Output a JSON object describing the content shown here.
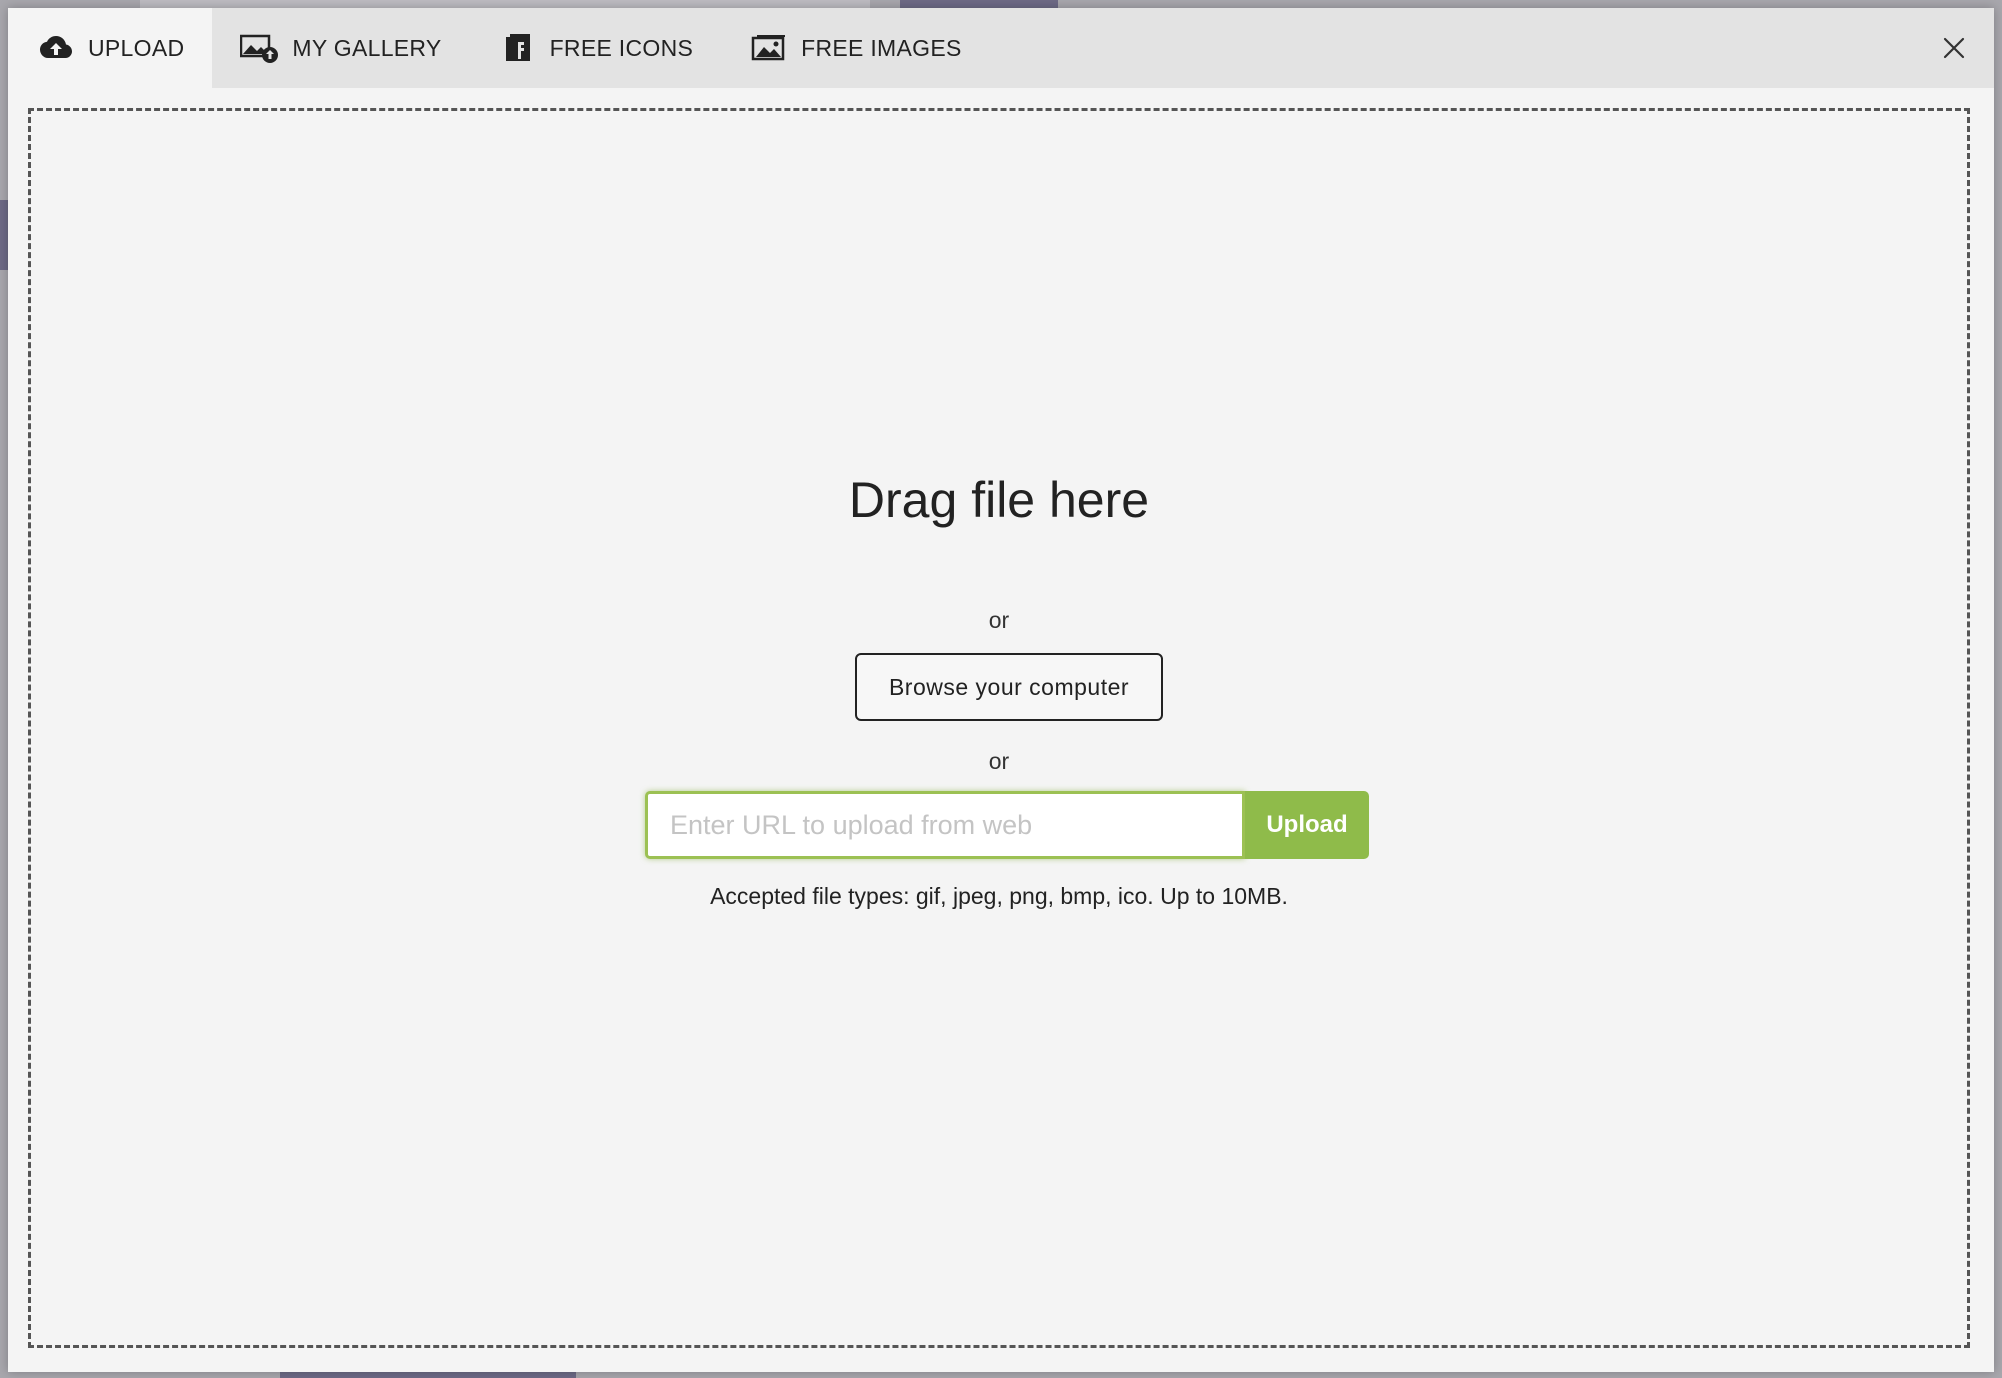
{
  "tabs": [
    {
      "label": "UPLOAD",
      "icon": "cloud-upload-icon",
      "active": true
    },
    {
      "label": "MY GALLERY",
      "icon": "gallery-upload-icon",
      "active": false
    },
    {
      "label": "FREE ICONS",
      "icon": "icon-library-icon",
      "active": false
    },
    {
      "label": "FREE IMAGES",
      "icon": "images-icon",
      "active": false
    }
  ],
  "close_icon": "close-icon",
  "dropzone": {
    "title": "Drag file here",
    "or_1": "or",
    "browse_label": "Browse your computer",
    "or_2": "or",
    "url_placeholder": "Enter URL to upload from web",
    "url_value": "",
    "upload_label": "Upload",
    "accepted_text": "Accepted file types: gif, jpeg, png, bmp, ico. Up to 10MB."
  },
  "colors": {
    "accent_green": "#8fbb4a",
    "input_focus_border": "#9cc153",
    "tabbar_bg": "#e3e3e3",
    "modal_bg": "#f4f4f4"
  }
}
